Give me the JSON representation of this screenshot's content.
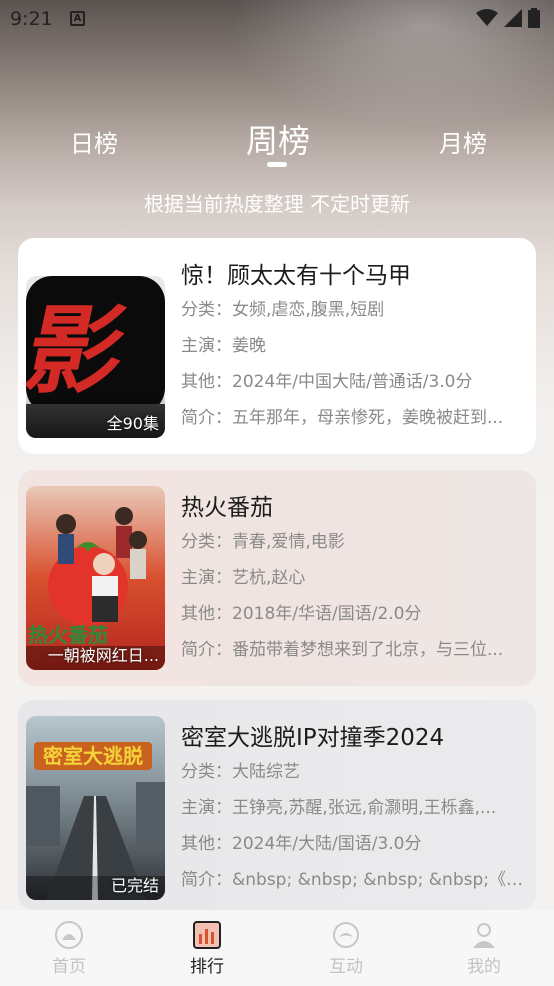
{
  "status": {
    "time": "9:21",
    "notif": "A"
  },
  "tabs": {
    "day": "日榜",
    "week": "周榜",
    "month": "月榜",
    "active": "week"
  },
  "subtitle": "根据当前热度整理 不定时更新",
  "list": [
    {
      "title": "惊！顾太太有十个马甲",
      "badge": "全90集",
      "poster_icon": "ying-logo",
      "category_label": "分类：",
      "category": "女频,虐恋,腹黑,短剧",
      "cast_label": "主演：",
      "cast": "姜晚",
      "other_label": "其他：",
      "other": "2024年/中国大陆/普通话/3.0分",
      "intro_label": "简介：",
      "intro": "五年那年，母亲惨死，姜晚被赶到..."
    },
    {
      "title": "热火番茄",
      "badge": "一朝被网红日...",
      "poster_icon": "tomato-poster",
      "category_label": "分类：",
      "category": "青春,爱情,电影",
      "cast_label": "主演：",
      "cast": "艺杭,赵心",
      "other_label": "其他：",
      "other": "2018年/华语/国语/2.0分",
      "intro_label": "简介：",
      "intro": "番茄带着梦想来到了北京，与三位..."
    },
    {
      "title": "密室大逃脱IP对撞季2024",
      "badge": "已完结",
      "poster_icon": "great-escape-poster",
      "category_label": "分类：",
      "category": "大陆综艺",
      "cast_label": "主演：",
      "cast": "王铮亮,苏醒,张远,俞灏明,王栎鑫,...",
      "other_label": "其他：",
      "other": "2024年/大陆/国语/3.0分",
      "intro_label": "简介：",
      "intro": "&nbsp; &nbsp; &nbsp; &nbsp;《密..."
    }
  ],
  "nav": {
    "home": "首页",
    "rank": "排行",
    "interact": "互动",
    "mine": "我的",
    "active": "rank"
  }
}
